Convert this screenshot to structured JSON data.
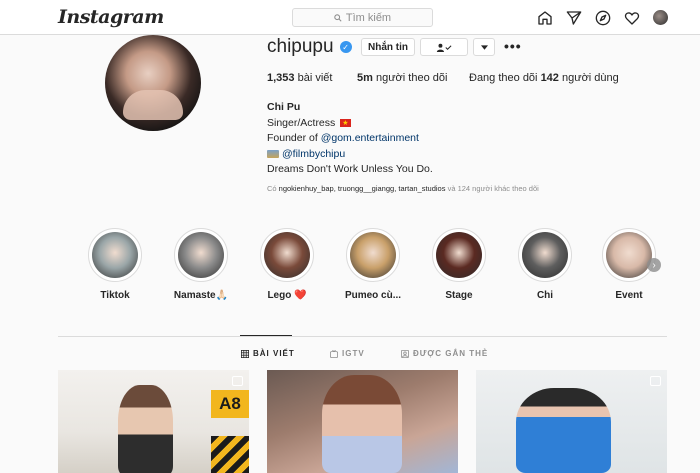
{
  "nav": {
    "logo": "Instagram",
    "search_placeholder": "Tìm kiếm",
    "icons": [
      "home-icon",
      "direct-icon",
      "explore-icon",
      "activity-heart-icon",
      "profile-avatar"
    ]
  },
  "profile": {
    "username": "chipupu",
    "verified": true,
    "message_button": "Nhắn tin",
    "follow_icon": "person-check-icon",
    "dropdown_icon": "triangle-down-icon",
    "more_label": "•••",
    "stats": {
      "posts_count": "1,353",
      "posts_label": " bài viết",
      "followers_count": "5m",
      "followers_label": " người theo dõi",
      "following_prefix": "Đang theo dõi ",
      "following_count": "142",
      "following_label": " người dùng"
    },
    "bio": {
      "name": "Chi Pu",
      "line1": "Singer/Actress",
      "line2_prefix": "Founder of ",
      "line2_link": "@gom.entertainment",
      "line3_link": "@filmbychipu",
      "line4": "Dreams Don't Work Unless You Do."
    },
    "followed_by": {
      "prefix": "Có ",
      "users": "ngokienhuy_bap, truongg__giangg, tartan_studios",
      "suffix": " và 124 người khác theo dõi"
    }
  },
  "highlights": [
    {
      "label": "Tiktok",
      "color": "#9aa6a8"
    },
    {
      "label": "Namaste🙏🏻",
      "color": "#8b8b8b"
    },
    {
      "label": "Lego ❤️",
      "color": "#7a4a3a"
    },
    {
      "label": "Pumeo cù...",
      "color": "#c9a06a"
    },
    {
      "label": "Stage",
      "color": "#5b2a22"
    },
    {
      "label": "Chi",
      "color": "#5e5e5e"
    },
    {
      "label": "Event",
      "color": "#d8b9a8"
    }
  ],
  "tabs": [
    {
      "label": "BÀI VIẾT",
      "icon": "grid-icon",
      "active": true
    },
    {
      "label": "IGTV",
      "icon": "igtv-icon",
      "active": false
    },
    {
      "label": "ĐƯỢC GẮN THẺ",
      "icon": "tagged-icon",
      "active": false
    }
  ],
  "posts": [
    {
      "sign_text": "A8"
    },
    {},
    {}
  ],
  "colors": {
    "link": "#003569",
    "verified": "#3897f0",
    "border": "#dbdbdb"
  }
}
